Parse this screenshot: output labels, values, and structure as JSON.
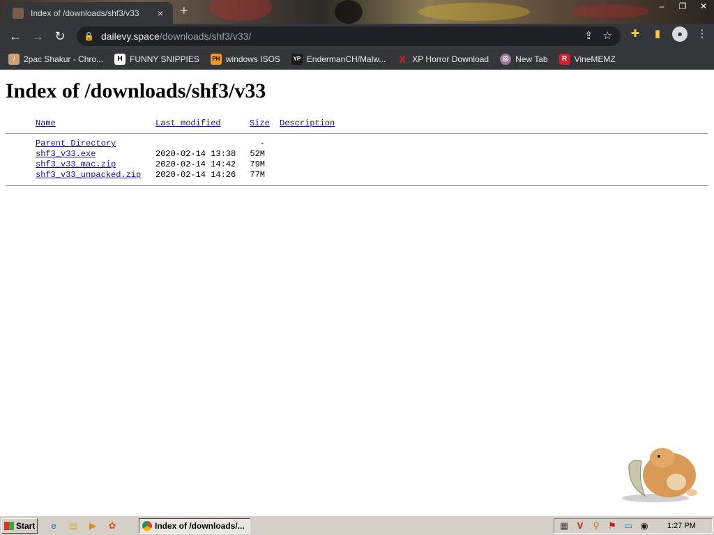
{
  "browser": {
    "tab_title": "Index of /downloads/shf3/v33",
    "tab_close": "×",
    "new_tab": "+",
    "url_host": "dailevy.space",
    "url_path": "/downloads/shf3/v33/",
    "bookmarks": [
      {
        "label": "2pac Shakur - Chro...",
        "icon": "music-icon",
        "color": "#c9a27a"
      },
      {
        "label": "FUNNY SNIPPIES",
        "icon": "H",
        "color": "#ffffff"
      },
      {
        "label": "windows ISOS",
        "icon": "PH",
        "color": "#f7971d"
      },
      {
        "label": "EndermanCH/Malw...",
        "icon": "YP",
        "color": "#1b1b1b"
      },
      {
        "label": "XP Horror Download",
        "icon": "X",
        "color": "#e0201a"
      },
      {
        "label": "New Tab",
        "icon": "globe-icon",
        "color": "#9a7aa0"
      },
      {
        "label": "VineMEMZ",
        "icon": "R",
        "color": "#d0202a"
      }
    ]
  },
  "page": {
    "heading": "Index of /downloads/shf3/v33",
    "columns": {
      "name": "Name",
      "modified": "Last modified",
      "size": "Size",
      "description": "Description"
    },
    "parent": {
      "name": "Parent Directory",
      "size": "-"
    },
    "files": [
      {
        "name": "shf3_v33.exe",
        "modified": "2020-02-14 13:38",
        "size": "52M"
      },
      {
        "name": "shf3_v33_mac.zip",
        "modified": "2020-02-14 14:42",
        "size": "79M"
      },
      {
        "name": "shf3_v33_unpacked.zip",
        "modified": "2020-02-14 14:26",
        "size": "77M"
      }
    ]
  },
  "taskbar": {
    "start_label": "Start",
    "window_label": "Index of /downloads/...",
    "clock": "1:27 PM"
  }
}
